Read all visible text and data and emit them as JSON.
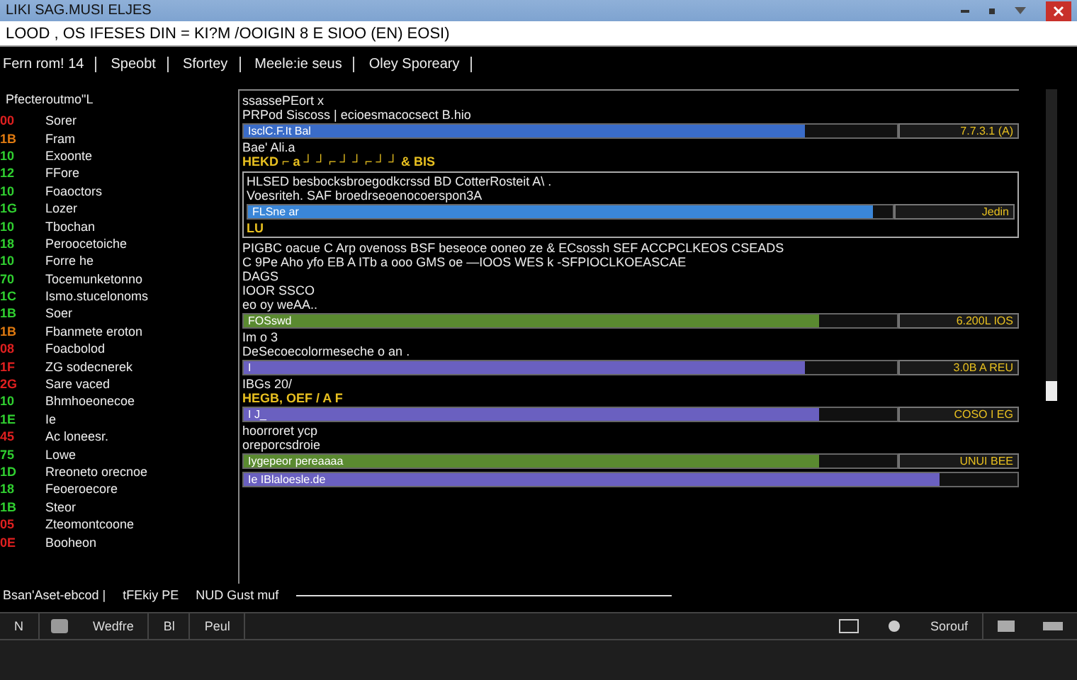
{
  "window": {
    "title": "LIKI SAG.MUSI ELJES"
  },
  "command_line": "LOOD , OS  IFESES DIN = KI?M /OOIGIN  8  E  SIOO (EN) EOSI)",
  "tabs": [
    "Fern rom! 14",
    "Speobt",
    "Sfortey",
    "Meele:ie seus",
    "Oley Sporeary"
  ],
  "list": {
    "header": "Pfecteroutmo\"L",
    "items": [
      {
        "code": "00",
        "name": "Sorer",
        "color": "#e02020"
      },
      {
        "code": "1B",
        "name": "Fram",
        "color": "#e07a10"
      },
      {
        "code": "10",
        "name": "Exoonte",
        "color": "#30d030"
      },
      {
        "code": "12",
        "name": "FFore",
        "color": "#30d030"
      },
      {
        "code": "10",
        "name": "Foaoctors",
        "color": "#30d030"
      },
      {
        "code": "1G",
        "name": "Lozer",
        "color": "#30d030"
      },
      {
        "code": "10",
        "name": "Tbochan",
        "color": "#30d030"
      },
      {
        "code": "18",
        "name": "Peroocetoiche",
        "color": "#30d030"
      },
      {
        "code": "10",
        "name": "Forre he",
        "color": "#30d030"
      },
      {
        "code": "70",
        "name": "Tocemunketonno",
        "color": "#30d030"
      },
      {
        "code": "1C",
        "name": "Ismo.stucelonoms",
        "color": "#30d030"
      },
      {
        "code": "1B",
        "name": "Soer",
        "color": "#30d030"
      },
      {
        "code": "1B",
        "name": "Fbanmete eroton",
        "color": "#e07a10"
      },
      {
        "code": "08",
        "name": "Foacbolod",
        "color": "#e02020"
      },
      {
        "code": "1F",
        "name": "ZG sodecnerek",
        "color": "#e02020"
      },
      {
        "code": "2G",
        "name": "Sare vaced",
        "color": "#e02020"
      },
      {
        "code": "10",
        "name": "Bhmhoeonecoe",
        "color": "#30d030"
      },
      {
        "code": "1E",
        "name": "Ie",
        "color": "#30d030"
      },
      {
        "code": "45",
        "name": "Ac loneesr.",
        "color": "#e02020"
      },
      {
        "code": "75",
        "name": "Lowe",
        "color": "#30d030"
      },
      {
        "code": "1D",
        "name": "Rreoneto orecnoe",
        "color": "#30d030"
      },
      {
        "code": "18",
        "name": "Feoeroecore",
        "color": "#30d030"
      },
      {
        "code": "1B",
        "name": "Steor",
        "color": "#30d030"
      },
      {
        "code": "05",
        "name": "Zteomontcoone",
        "color": "#e02020"
      },
      {
        "code": "0E",
        "name": "Booheon",
        "color": "#e02020"
      }
    ]
  },
  "panel": {
    "items": [
      {
        "kind": "line",
        "text": "ssassePEort x"
      },
      {
        "kind": "line",
        "text": "PRPod  Siscoss | ecioesmacocsect  B.hio"
      },
      {
        "kind": "bar",
        "label": "IsclC.F.It Bal",
        "level": 0.86,
        "reading": "7.7.3.1 (A)",
        "color": "#3a6cc8"
      },
      {
        "kind": "line",
        "text": "Bae' Ali.a"
      },
      {
        "kind": "highlight",
        "text": "HEKD  ⌐ a ┘ ┘ ⌐ ┘ ┘ ⌐ ┘ ┘  & BIS"
      },
      {
        "kind": "group",
        "children": [
          {
            "kind": "line",
            "text": "HLSED besbocksbroegodkcrssd BD  CotterRosteit  A\\ ."
          },
          {
            "kind": "line",
            "text": "Voesriteh. SAF broedrseoenocoerspon3A"
          },
          {
            "kind": "bar",
            "label": "FLSne ar",
            "level": 0.97,
            "reading": "Jedin",
            "color": "#3a86d8"
          },
          {
            "kind": "highlight",
            "text": "LU"
          }
        ]
      },
      {
        "kind": "line",
        "text": "PIGBC oacue C Arp ovenoss BSF beseoce ooneo ze  & ECsossh SEF  ACCPCLKEOS  CSEADS"
      },
      {
        "kind": "line",
        "text": "C 9Pe  Aho  yfo EB A  ITb  a ooo  GMS oe  —IOOS WES k  -SFPIOCLKOEASCAE"
      },
      {
        "kind": "line",
        "text": "DAGS"
      },
      {
        "kind": "line",
        "text": "IOOR SSCO"
      },
      {
        "kind": "line",
        "text": "eo oy weAA.."
      },
      {
        "kind": "bar",
        "label": "FOSswd",
        "level": 0.88,
        "reading": "6.200L IOS",
        "color": "#5a8a30"
      },
      {
        "kind": "line",
        "text": "Im o 3"
      },
      {
        "kind": "line",
        "text": "DeSecoecolormeseche o an  ."
      },
      {
        "kind": "bar",
        "label": "I",
        "level": 0.86,
        "reading": "3.0B A REU",
        "color": "#6a60c0"
      },
      {
        "kind": "line",
        "text": "IBGs 20/"
      },
      {
        "kind": "highlight",
        "text": "HEGB,  OEF / A F"
      },
      {
        "kind": "bar",
        "label": "I J_",
        "level": 0.88,
        "reading": "COSO I EG",
        "color": "#6a60c0"
      },
      {
        "kind": "line",
        "text": "hoorroret  ycp"
      },
      {
        "kind": "line",
        "text": "oreporcsdroie"
      },
      {
        "kind": "bar",
        "label": "Iygepeor pereaaaa",
        "level": 0.88,
        "reading": "UNUI BEE",
        "color": "#5a8a30"
      },
      {
        "kind": "bar",
        "label": "Ie IBlaloesle.de",
        "level": 0.9,
        "color": "#6a60c0"
      }
    ]
  },
  "status_line": [
    "Bsan'Aset-ebcod |",
    "tFEkiy PE",
    "NUD Gust muf"
  ],
  "taskbar": {
    "left": [
      "N",
      "Wedfre",
      "Bl",
      "Peul"
    ],
    "right": [
      "Sorouf"
    ]
  }
}
